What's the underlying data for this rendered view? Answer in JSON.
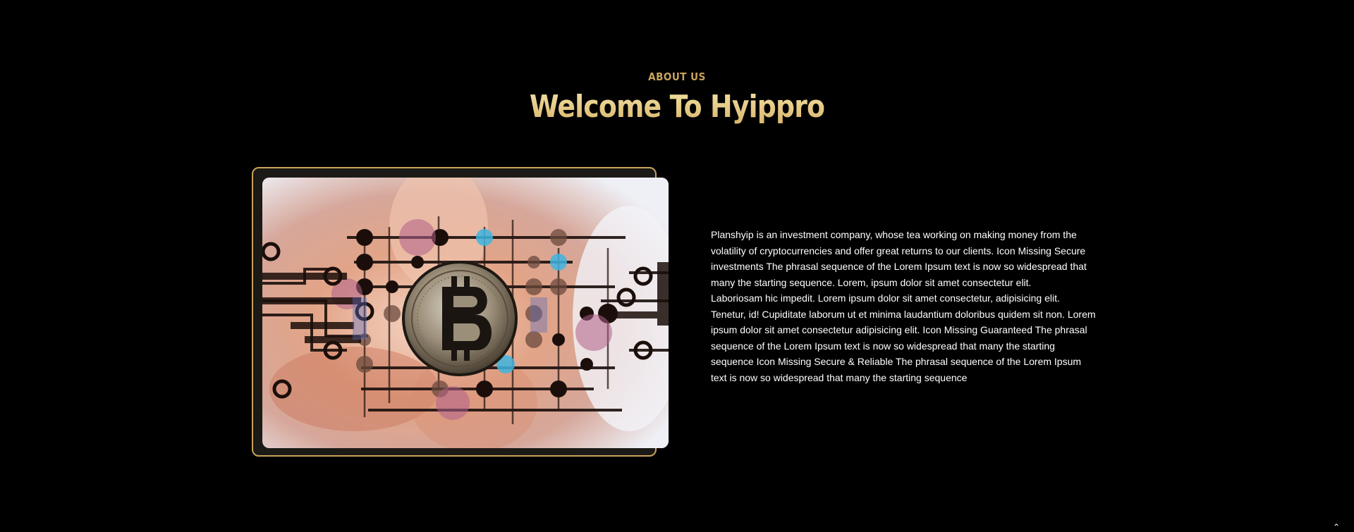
{
  "about": {
    "label": "ABOUT US",
    "title": "Welcome To Hyippro",
    "image_alt": "bitcoin-circuit-photo",
    "paragraph_1": "Planshyip is an investment company, whose tea working on making money from the volatility of cryptocurrencies and offer great returns to our clients. Icon Missing Secure investments The phrasal sequence of the Lorem Ipsum text is now so widespread that many the starting sequence. Lorem, ipsum dolor sit amet consectetur elit.",
    "paragraph_2": "Laboriosam hic impedit. Lorem ipsum dolor sit amet consectetur, adipisicing elit. Tenetur, id! Cupiditate laborum ut et minima laudantium doloribus quidem sit non. Lorem ipsum dolor sit amet consectetur adipisicing elit. Icon Missing Guaranteed The phrasal sequence of the Lorem Ipsum text is now so widespread that many the starting sequence Icon Missing Secure & Reliable The phrasal sequence of the Lorem Ipsum text is now so widespread that many the starting sequence"
  },
  "colors": {
    "background": "#000000",
    "accent_gold": "#c9a25c",
    "title_gold": "#e9cf8a",
    "text": "#ffffff"
  },
  "icons": {
    "scroll_top": "chevron-up-icon"
  }
}
